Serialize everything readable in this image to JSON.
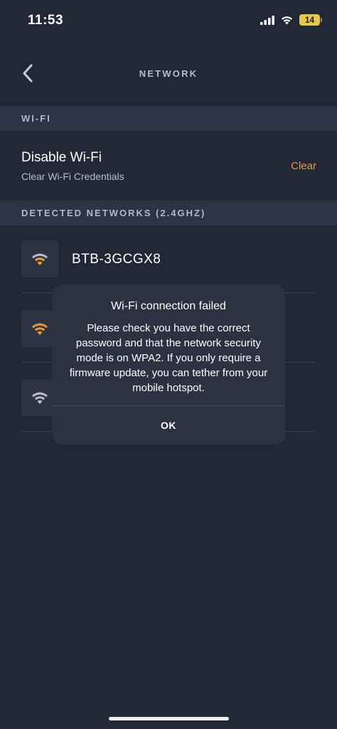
{
  "status_bar": {
    "time": "11:53",
    "battery_level": "14",
    "icons": [
      "cellular-signal-icon",
      "wifi-status-icon",
      "battery-icon"
    ]
  },
  "header": {
    "title": "NETWORK",
    "back_icon": "chevron-left-icon"
  },
  "wifi_section": {
    "header": "WI-FI",
    "row_title": "Disable Wi-Fi",
    "row_subtitle": "Clear Wi-Fi Credentials",
    "action_label": "Clear"
  },
  "networks_section": {
    "header": "DETECTED NETWORKS (2.4GHZ)",
    "networks": [
      {
        "name": "BTB-3GCGX8",
        "icon": "wifi-signal-icon"
      },
      {
        "name": "",
        "icon": "wifi-signal-icon"
      },
      {
        "name": "",
        "icon": "wifi-signal-icon"
      }
    ]
  },
  "dialog": {
    "title": "Wi-Fi connection failed",
    "message": "Please check you have the correct password and that the network security mode is on WPA2. If you only require a firmware update, you can tether from your mobile hotspot.",
    "ok_label": "OK"
  },
  "colors": {
    "background": "#232837",
    "section_header_bg": "#2e3445",
    "accent": "#e89b2c",
    "dialog_bg": "#2c3241"
  }
}
